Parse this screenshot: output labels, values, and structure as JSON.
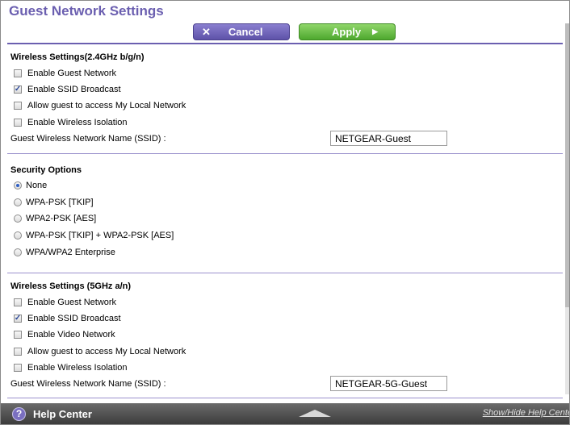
{
  "page": {
    "title": "Guest Network Settings"
  },
  "actions": {
    "cancel_label": "Cancel",
    "apply_label": "Apply"
  },
  "wireless_24": {
    "title": "Wireless Settings(2.4GHz b/g/n)",
    "options": [
      {
        "label": "Enable Guest Network",
        "checked": false
      },
      {
        "label": "Enable SSID Broadcast",
        "checked": true
      },
      {
        "label": "Allow guest to access My Local Network",
        "checked": false
      },
      {
        "label": "Enable Wireless Isolation",
        "checked": false
      }
    ],
    "ssid_label": "Guest Wireless Network Name (SSID) :",
    "ssid_value": "NETGEAR-Guest"
  },
  "security": {
    "title": "Security Options",
    "options": [
      {
        "label": "None",
        "selected": true
      },
      {
        "label": "WPA-PSK [TKIP]",
        "selected": false
      },
      {
        "label": "WPA2-PSK [AES]",
        "selected": false
      },
      {
        "label": "WPA-PSK [TKIP] + WPA2-PSK [AES]",
        "selected": false
      },
      {
        "label": "WPA/WPA2 Enterprise",
        "selected": false
      }
    ]
  },
  "wireless_5": {
    "title": "Wireless Settings (5GHz a/n)",
    "options": [
      {
        "label": "Enable Guest Network",
        "checked": false
      },
      {
        "label": "Enable SSID Broadcast",
        "checked": true
      },
      {
        "label": "Enable Video Network",
        "checked": false
      },
      {
        "label": "Allow guest to access My Local Network",
        "checked": false
      },
      {
        "label": "Enable Wireless Isolation",
        "checked": false
      }
    ],
    "ssid_label": "Guest Wireless Network Name (SSID) :",
    "ssid_value": "NETGEAR-5G-Guest"
  },
  "help": {
    "label": "Help Center",
    "toggle_link": "Show/Hide Help Cente"
  },
  "colors": {
    "accent": "#6b5fb0",
    "apply_green": "#4ea82e",
    "cancel_purple": "#5e52a8",
    "radio_blue": "#2f5fc5"
  }
}
